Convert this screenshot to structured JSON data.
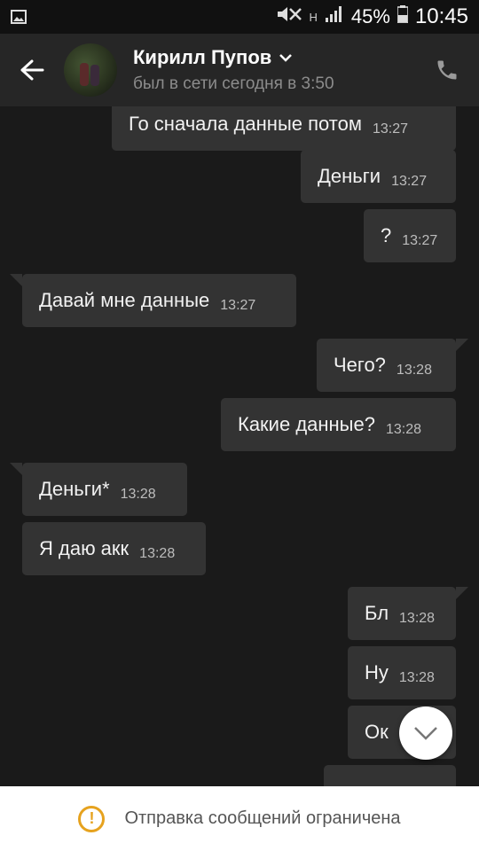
{
  "status_bar": {
    "battery": "45%",
    "time": "10:45",
    "network_badge": "H"
  },
  "header": {
    "contact_name": "Кирилл Пупов",
    "last_seen": "был в сети сегодня в 3:50"
  },
  "messages": [
    {
      "direction": "out",
      "text": "Го сначала данные потом",
      "time": "13:27"
    },
    {
      "direction": "out",
      "text": "Деньги",
      "time": "13:27"
    },
    {
      "direction": "out",
      "text": "?",
      "time": "13:27"
    },
    {
      "direction": "in",
      "text": "Давай мне данные",
      "time": "13:27"
    },
    {
      "direction": "out",
      "text": "Чего?",
      "time": "13:28"
    },
    {
      "direction": "out",
      "text": "Какие данные?",
      "time": "13:28"
    },
    {
      "direction": "in",
      "text": "Деньги*",
      "time": "13:28"
    },
    {
      "direction": "in",
      "text": "Я даю акк",
      "time": "13:28"
    },
    {
      "direction": "out",
      "text": "Бл",
      "time": "13:28"
    },
    {
      "direction": "out",
      "text": "Ну",
      "time": "13:28"
    },
    {
      "direction": "out",
      "text": "Ок",
      "time": ""
    }
  ],
  "banner": {
    "text": "Отправка сообщений ограничена",
    "icon_label": "!"
  },
  "colors": {
    "background": "#1a1a1a",
    "header": "#262626",
    "bubble": "#333333",
    "warning": "#e6a21e"
  }
}
